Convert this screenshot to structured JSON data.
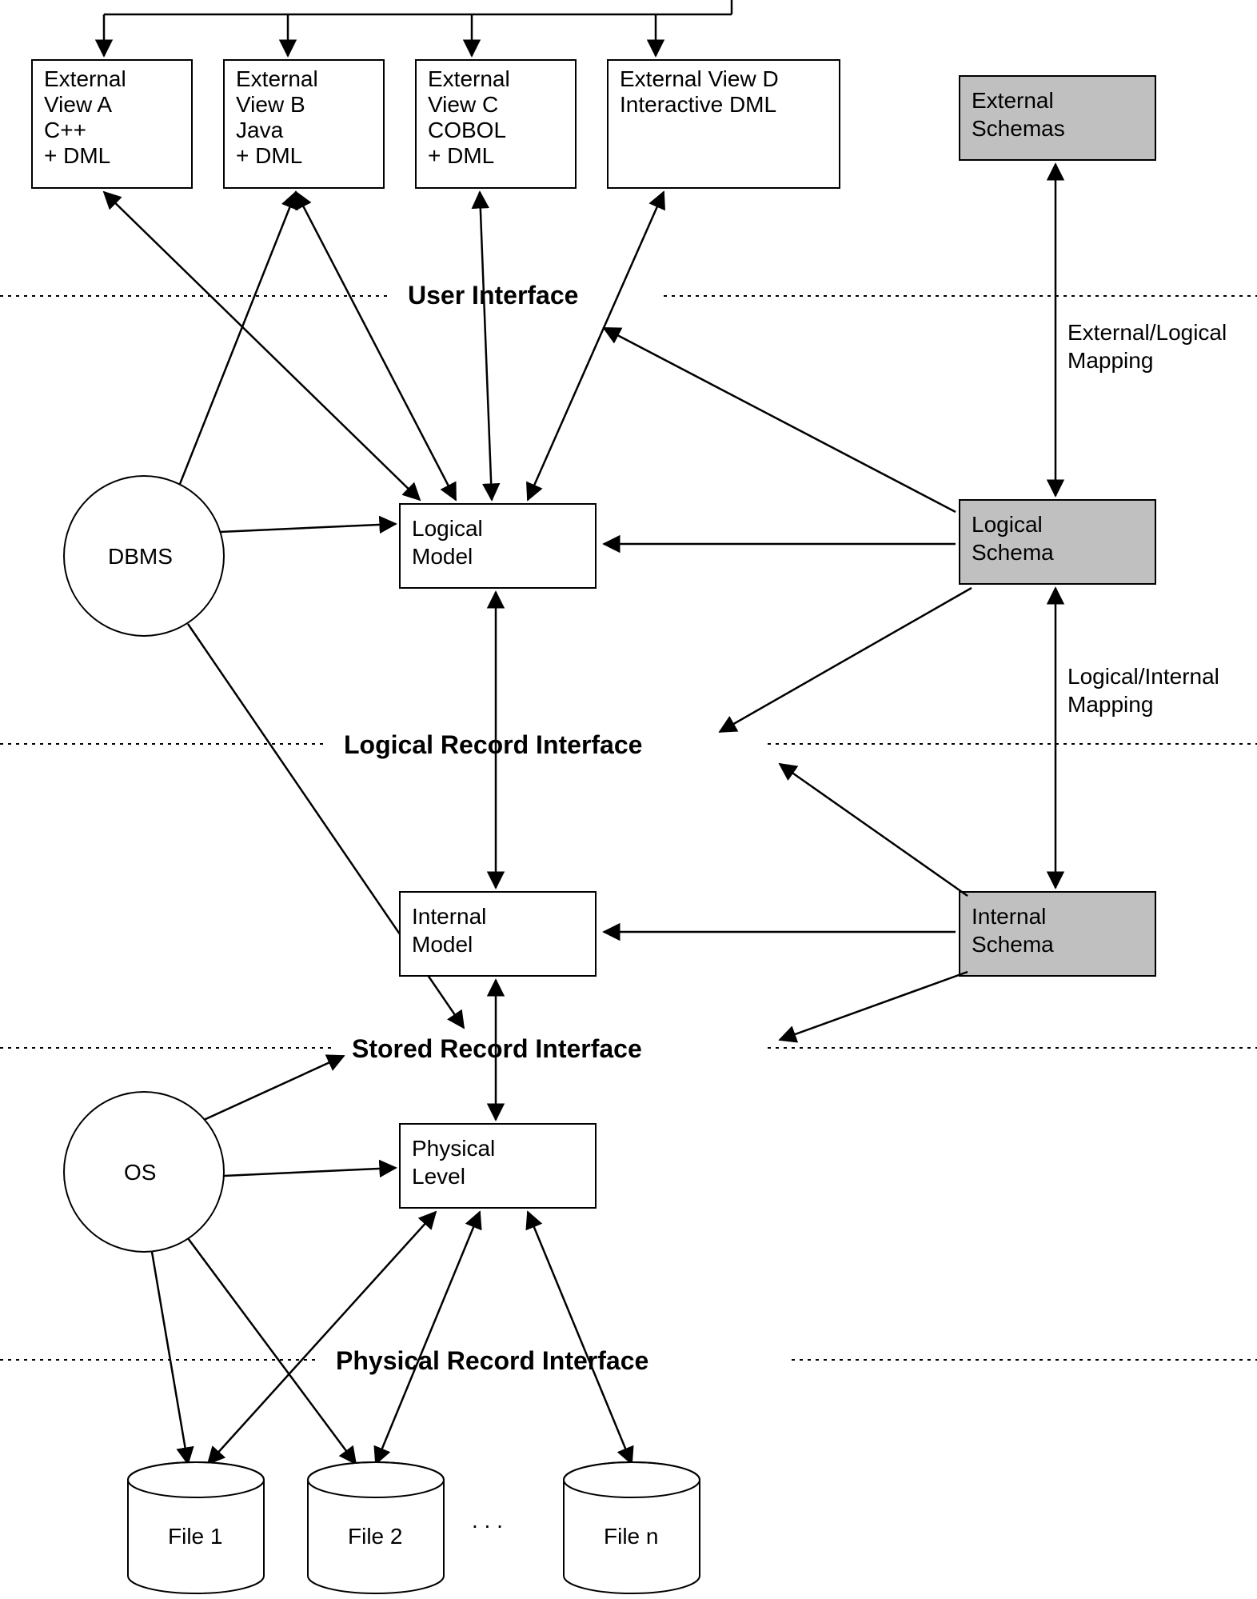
{
  "boxes": {
    "viewA": {
      "lines": [
        "External",
        "View A",
        "C++",
        "+ DML"
      ]
    },
    "viewB": {
      "lines": [
        "External",
        "View B",
        "Java",
        "+ DML"
      ]
    },
    "viewC": {
      "lines": [
        "External",
        "View C",
        "COBOL",
        "+ DML"
      ]
    },
    "viewD": {
      "lines": [
        "External View D",
        "Interactive DML"
      ]
    },
    "extSchemas": {
      "lines": [
        "External",
        "Schemas"
      ]
    },
    "logicalModel": {
      "lines": [
        "Logical",
        "Model"
      ]
    },
    "logicalSchema": {
      "lines": [
        "Logical",
        "Schema"
      ]
    },
    "internalModel": {
      "lines": [
        "Internal",
        "Model"
      ]
    },
    "internalSchema": {
      "lines": [
        "Internal",
        "Schema"
      ]
    },
    "physicalLevel": {
      "lines": [
        "Physical",
        "Level"
      ]
    }
  },
  "circles": {
    "dbms": {
      "label": "DBMS"
    },
    "os": {
      "label": "OS"
    }
  },
  "cylinders": {
    "file1": {
      "label": "File 1"
    },
    "file2": {
      "label": "File 2"
    },
    "dots": {
      "label": ". . ."
    },
    "filen": {
      "label": "File n"
    }
  },
  "interfaces": {
    "user": {
      "label": "User Interface"
    },
    "logical": {
      "label": "Logical Record Interface"
    },
    "stored": {
      "label": "Stored Record Interface"
    },
    "physical": {
      "label": "Physical Record Interface"
    }
  },
  "mappings": {
    "extLogical": {
      "lines": [
        "External/Logical",
        "Mapping"
      ]
    },
    "logInternal": {
      "lines": [
        "Logical/Internal",
        "Mapping"
      ]
    }
  }
}
